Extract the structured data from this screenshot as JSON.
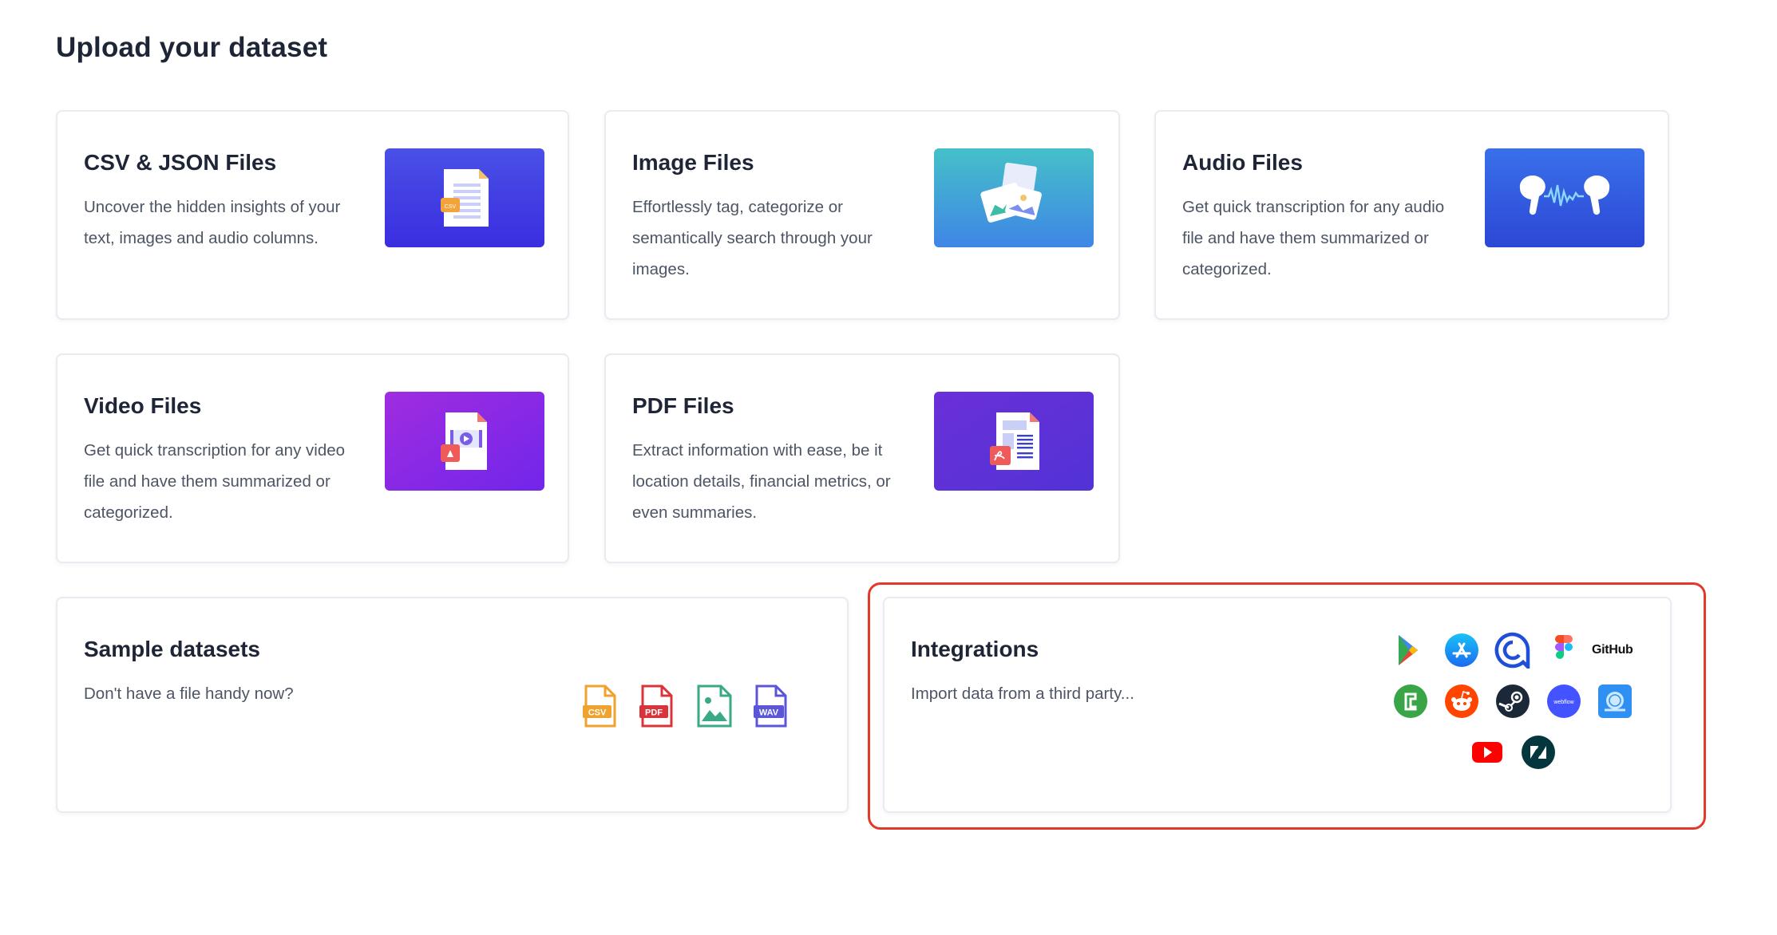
{
  "page": {
    "title": "Upload your dataset"
  },
  "cards": [
    {
      "title": "CSV & JSON Files",
      "description": "Uncover the hidden insights of your text, images and audio columns.",
      "thumb_colors": [
        "#4a50e6",
        "#3a2ee0"
      ],
      "badge_label": "CSV"
    },
    {
      "title": "Image Files",
      "description": "Effortlessly tag, categorize or semantically search through your images.",
      "thumb_colors": [
        "#45c0c8",
        "#3f86e6"
      ]
    },
    {
      "title": "Audio Files",
      "description": "Get quick transcription for any audio file and have them summarized or categorized.",
      "thumb_colors": [
        "#3a70ea",
        "#2c47d6"
      ]
    },
    {
      "title": "Video Files",
      "description": "Get quick transcription for any video file and have them summarized or categorized.",
      "thumb_colors": [
        "#a02ce0",
        "#7126ea"
      ]
    },
    {
      "title": "PDF Files",
      "description": "Extract information with ease, be it location details, financial metrics, or even summaries.",
      "thumb_colors": [
        "#6a2fd8",
        "#5233d6"
      ]
    }
  ],
  "sample": {
    "title": "Sample datasets",
    "description": "Don't have a file handy now?",
    "files": [
      {
        "label": "CSV",
        "color": "#f0a22e",
        "icon": "csv-file-icon"
      },
      {
        "label": "PDF",
        "color": "#d8343a",
        "icon": "pdf-file-icon"
      },
      {
        "label": "",
        "color": "#3aa987",
        "icon": "image-file-icon"
      },
      {
        "label": "WAV",
        "color": "#5b56d8",
        "icon": "wav-file-icon"
      }
    ]
  },
  "integrations": {
    "title": "Integrations",
    "description": "Import data from a third party...",
    "github_label": "GitHub",
    "icons": [
      "google-play-icon",
      "app-store-icon",
      "q-logo-icon",
      "figma-icon",
      "github-icon",
      "green-app-icon",
      "reddit-icon",
      "steam-icon",
      "webflow-icon",
      "blue-globe-icon",
      "youtube-icon",
      "zendesk-icon"
    ],
    "webflow_label": "webflow"
  },
  "colors": {
    "highlight": "#e3392a",
    "card_border": "#e9ebf2"
  }
}
